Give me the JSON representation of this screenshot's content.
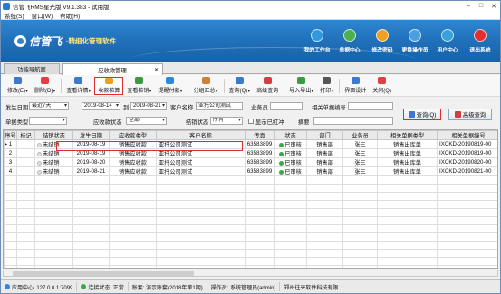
{
  "window": {
    "title": "信管飞RMS星光版 V9.1.383 - 试用版",
    "min": "–",
    "max": "□",
    "close": "✕"
  },
  "menu": [
    "系统(S)",
    "窗口(W)",
    "帮助(H)"
  ],
  "banner": {
    "logo": "信管飞",
    "slogan": "·精细化管理软件",
    "nav": [
      {
        "label": "我的工作台",
        "color": "#2f9ae0"
      },
      {
        "label": "单据中心",
        "color": "#4cb050"
      },
      {
        "label": "修改密码",
        "color": "#f0a020"
      },
      {
        "label": "更换操作员",
        "color": "#4aa0e0"
      },
      {
        "label": "用户中心",
        "color": "#3aa0d8"
      },
      {
        "label": "退出系统",
        "color": "#e03030"
      }
    ]
  },
  "tabs": [
    {
      "label": "功能导航面"
    },
    {
      "label": "应收款管理",
      "close": "✕"
    }
  ],
  "toolbar": [
    {
      "label": "修改(E)",
      "color": "#3a7ad0",
      "arrow": "▾"
    },
    {
      "label": "删除(D)",
      "color": "#e04040",
      "arrow": "▾"
    },
    {
      "label": "查看详情",
      "color": "#3a7ad0",
      "arrow": "▾"
    },
    {
      "label": "收款核算",
      "color": "#f0a020",
      "hl": true
    },
    {
      "label": "查看核销",
      "color": "#3a9a40",
      "arrow": "▾"
    },
    {
      "label": "提醒付款",
      "color": "#2a8ae0",
      "arrow": "▾"
    },
    {
      "label": "分组汇总",
      "color": "#d08030",
      "arrow": "▾"
    },
    {
      "label": "查询(Q)",
      "color": "#3a7ad0",
      "arrow": "▾"
    },
    {
      "label": "高级查询",
      "color": "#d04040"
    },
    {
      "label": "导入导出",
      "color": "#3a9a40",
      "arrow": "▾"
    },
    {
      "label": "打印",
      "color": "#555555",
      "arrow": "▾"
    },
    {
      "label": "界面设计",
      "color": "#3a7ad0"
    },
    {
      "label": "关闭(Q)",
      "color": "#e04040"
    }
  ],
  "filters": {
    "date_label": "发生日期",
    "date_range": "最近7天",
    "date_from": "2019-08-14",
    "to": "到",
    "date_to": "2019-08-21",
    "customer_label": "客户名称",
    "customer": "亚托公司测试",
    "clerk_label": "业务员",
    "clerk": "",
    "ref_label": "相关单据编号",
    "ref": "",
    "type_label": "单据类型",
    "type": "",
    "status_label": "应收款状态",
    "status": "全部",
    "wo_label": "结销状态",
    "wo": "所有",
    "show_closed": "显示已红冲",
    "summary_label": "摘要",
    "summary": "",
    "query_btn": "查询(Q)",
    "adv_btn": "高级查询"
  },
  "grid": {
    "headers": [
      "序号",
      "标记",
      "结销状态",
      "发生日期",
      "应收款类型",
      "客户名称",
      "传真",
      "状态",
      "部门",
      "业务员",
      "相关单据类型",
      "相关单据编号"
    ],
    "rows": [
      [
        "1",
        "",
        "未结销",
        "2019-08-19",
        "销售应收款",
        "亚托公司测试",
        "63583899",
        "已审核",
        "销售部",
        "张三",
        "销售出库单",
        "IXCKD-20190819-00"
      ],
      [
        "2",
        "",
        "未结销",
        "2019-08-19",
        "销售应收款",
        "亚托公司测试",
        "63583899",
        "已审核",
        "销售部",
        "张三",
        "销售出库单",
        "IXCKD-20190819-00"
      ],
      [
        "3",
        "",
        "未结销",
        "2019-08-20",
        "销售应收款",
        "亚托公司测试",
        "63583899",
        "已审核",
        "销售部",
        "张三",
        "销售出库单",
        "IXCKD-20190820-00"
      ],
      [
        "4",
        "",
        "未结销",
        "2019-08-21",
        "销售应收款",
        "亚托公司测试",
        "63583899",
        "已审核",
        "销售部",
        "张三",
        "销售出库单",
        "IXCKD-20190821-00"
      ]
    ]
  },
  "status": [
    "应用中心: 127.0.0.1:7099",
    "连接状态: 正常",
    "账套: 演示账套(2018年第1期)",
    "操作员: 系统管理员(admin)",
    "郑州往来软件科技有限"
  ],
  "colors": {
    "accent": "#1f6fb8",
    "highlight": "#e12b2b",
    "ok": "#39a849"
  }
}
